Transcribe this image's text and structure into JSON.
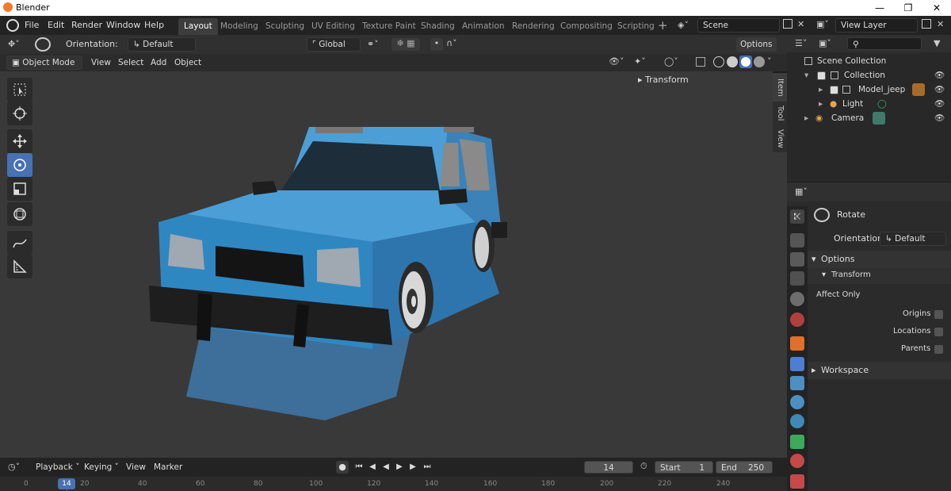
{
  "window": {
    "title": "Blender"
  },
  "menu": [
    "File",
    "Edit",
    "Render",
    "Window",
    "Help"
  ],
  "workspaces": [
    "Layout",
    "Modeling",
    "Sculpting",
    "UV Editing",
    "Texture Paint",
    "Shading",
    "Animation",
    "Rendering",
    "Compositing",
    "Scripting"
  ],
  "scene": {
    "name": "Scene",
    "view_layer": "View Layer"
  },
  "tool_header": {
    "orientation_label": "Orientation:",
    "orientation_value": "Default",
    "transform_space": "Global",
    "options": "Options"
  },
  "viewport_header": {
    "mode": "Object Mode",
    "menus": [
      "View",
      "Select",
      "Add",
      "Object"
    ]
  },
  "n_panel": {
    "transform": "Transform",
    "tabs": [
      "Item",
      "Tool",
      "View"
    ]
  },
  "outliner": {
    "root": "Scene Collection",
    "collection": "Collection",
    "items": [
      "Model_jeep",
      "Light",
      "Camera"
    ]
  },
  "properties": {
    "tool_name": "Rotate",
    "orientation_label": "Orientation",
    "orientation_value": "Default",
    "options": "Options",
    "transform": "Transform",
    "affect_only": "Affect Only",
    "checks": [
      "Origins",
      "Locations",
      "Parents"
    ],
    "workspace": "Workspace"
  },
  "timeline": {
    "menus": [
      "Playback",
      "Keying",
      "View",
      "Marker"
    ],
    "current_frame": "14",
    "start_label": "Start",
    "start": "1",
    "end_label": "End",
    "end": "250",
    "ticks": [
      "0",
      "14",
      "20",
      "40",
      "60",
      "80",
      "100",
      "120",
      "140",
      "160",
      "180",
      "200",
      "220",
      "240"
    ]
  },
  "colors": {
    "accent": "#4772b3",
    "jeep_body": "#3f93c8"
  }
}
